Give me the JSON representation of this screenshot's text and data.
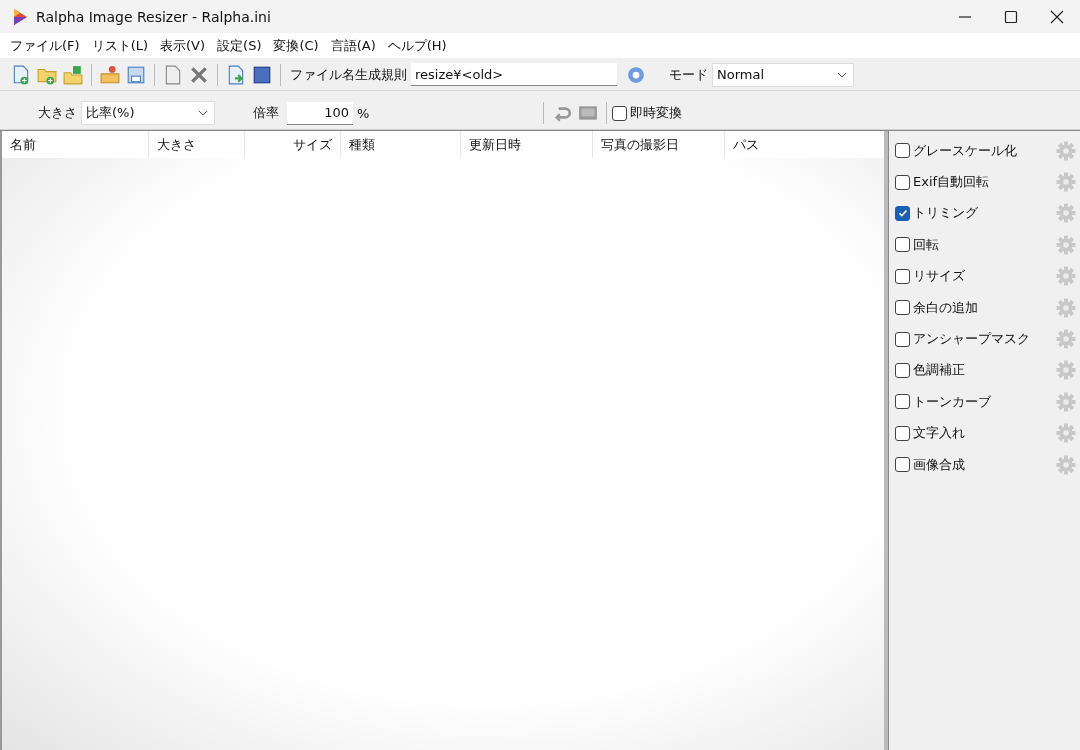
{
  "window": {
    "title": "Ralpha Image Resizer - Ralpha.ini"
  },
  "menu": [
    "ファイル(F)",
    "リスト(L)",
    "表示(V)",
    "設定(S)",
    "変換(C)",
    "言語(A)",
    "ヘルプ(H)"
  ],
  "toolbar": {
    "rule_label": "ファイル名生成規則",
    "rule_value": "resize¥<old>",
    "mode_label": "モード",
    "mode_value": "Normal"
  },
  "size_bar": {
    "size_label": "大きさ",
    "size_value": "比率(%)",
    "ratio_label": "倍率",
    "ratio_value": "100",
    "ratio_unit": "%",
    "instant": {
      "label": "即時変換",
      "checked": false
    }
  },
  "table": {
    "columns": [
      "名前",
      "大きさ",
      "サイズ",
      "種類",
      "更新日時",
      "写真の撮影日",
      "パス"
    ]
  },
  "options": [
    {
      "label": "グレースケール化",
      "checked": false
    },
    {
      "label": "Exif自動回転",
      "checked": false
    },
    {
      "label": "トリミング",
      "checked": true
    },
    {
      "label": "回転",
      "checked": false
    },
    {
      "label": "リサイズ",
      "checked": false
    },
    {
      "label": "余白の追加",
      "checked": false
    },
    {
      "label": "アンシャープマスク",
      "checked": false
    },
    {
      "label": "色調補正",
      "checked": false
    },
    {
      "label": "トーンカーブ",
      "checked": false
    },
    {
      "label": "文字入れ",
      "checked": false
    },
    {
      "label": "画像合成",
      "checked": false
    }
  ]
}
